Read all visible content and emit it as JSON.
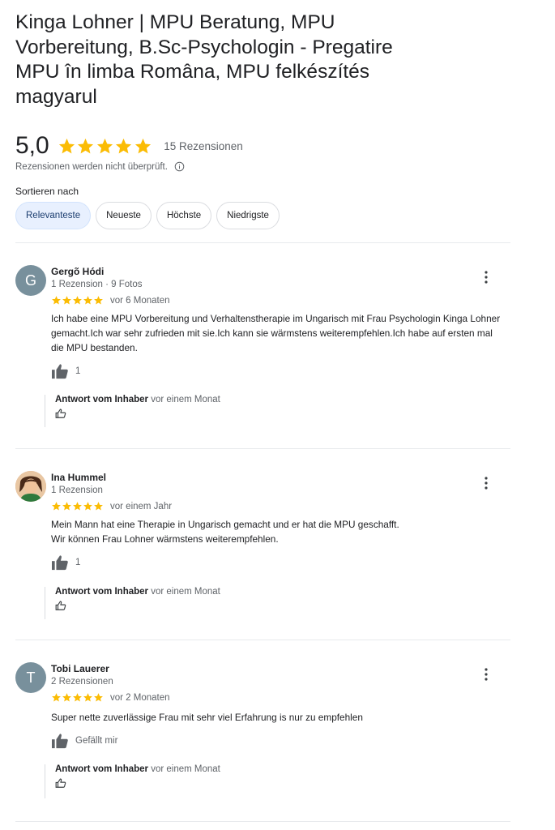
{
  "header": {
    "title": "Kinga Lohner | MPU Beratung, MPU Vorbereitung, B.Sc-Psychologin - Pregatire MPU în limba Româna, MPU felkészítés magyarul",
    "rating": "5,0",
    "stars": 5,
    "count": "15 Rezensionen",
    "disclaimer": "Rezensionen werden nicht überprüft."
  },
  "sort": {
    "label": "Sortieren nach",
    "chips": [
      "Relevanteste",
      "Neueste",
      "Höchste",
      "Niedrigste"
    ],
    "active": "Relevanteste"
  },
  "colors": {
    "star": "#fbbc04",
    "chip_active_bg": "#e8f0fe",
    "avatar_bg": "#78909c"
  },
  "reviews": [
    {
      "name": "Gergõ Hódi",
      "avatar_letter": "G",
      "meta": "1 Rezension · 9 Fotos",
      "stars": 5,
      "time": "vor 6 Monaten",
      "text": "Ich habe eine MPU Vorbereitung und Verhaltenstherapie im Ungarisch mit Frau Psychologin Kinga Lohner gemacht.Ich war sehr zufrieden mit sie.Ich kann sie wärmstens weiterempfehlen.Ich habe auf ersten mal die MPU bestanden.",
      "likes": "1",
      "owner_label": "Antwort vom Inhaber",
      "owner_time": "vor einem Monat"
    },
    {
      "name": "Ina Hummel",
      "avatar_letter": "",
      "meta": "1 Rezension",
      "stars": 5,
      "time": "vor einem Jahr",
      "text_line1": "Mein Mann hat eine Therapie in Ungarisch gemacht und er hat die MPU geschafft.",
      "text_line2": "Wir können Frau Lohner wärmstens weiterempfehlen.",
      "likes": "1",
      "owner_label": "Antwort vom Inhaber",
      "owner_time": "vor einem Monat"
    },
    {
      "name": "Tobi Lauerer",
      "avatar_letter": "T",
      "meta": "2 Rezensionen",
      "stars": 5,
      "time": "vor 2 Monaten",
      "text": "Super nette zuverlässige Frau mit sehr viel Erfahrung is nur zu empfehlen",
      "likes": "Gefällt mir",
      "owner_label": "Antwort vom Inhaber",
      "owner_time": "vor einem Monat"
    }
  ]
}
